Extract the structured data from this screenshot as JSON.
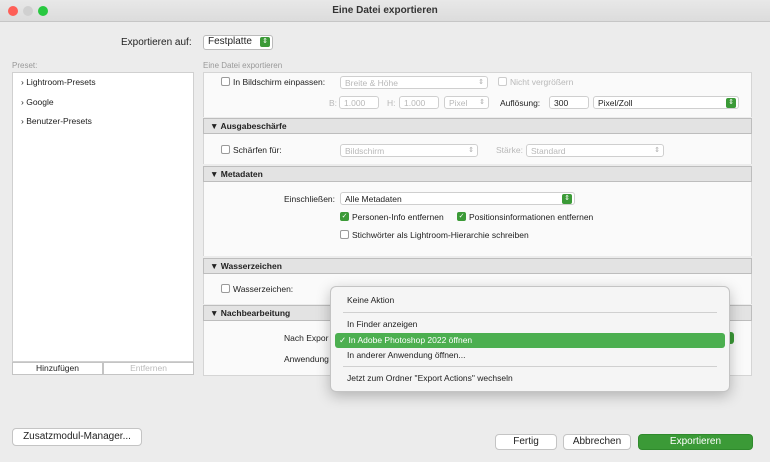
{
  "window": {
    "title": "Eine Datei exportieren"
  },
  "export_to": {
    "label": "Exportieren auf:",
    "value": "Festplatte"
  },
  "preset": {
    "header": "Preset:",
    "items": [
      "Lightroom-Presets",
      "Google",
      "Benutzer-Presets"
    ],
    "add_label": "Hinzufügen",
    "remove_label": "Entfernen"
  },
  "right_header": "Eine Datei exportieren",
  "sizing": {
    "fit_label": "In Bildschirm einpassen:",
    "fit_value": "Breite & Höhe",
    "no_enlarge_label": "Nicht vergrößern",
    "b_label": "B:",
    "b_value": "1.000",
    "h_label": "H:",
    "h_value": "1.000",
    "unit": "Pixel",
    "resolution_label": "Auflösung:",
    "resolution_value": "300",
    "resolution_unit": "Pixel/Zoll"
  },
  "sharpening": {
    "header": "Ausgabeschärfe",
    "sharpen_label": "Schärfen für:",
    "sharpen_value": "Bildschirm",
    "strength_label": "Stärke:",
    "strength_value": "Standard"
  },
  "metadata": {
    "header": "Metadaten",
    "include_label": "Einschließen:",
    "include_value": "Alle Metadaten",
    "remove_person": "Personen-Info entfernen",
    "remove_location": "Positionsinformationen entfernen",
    "keywords_hierarchy": "Stichwörter als Lightroom-Hierarchie schreiben"
  },
  "watermark": {
    "header": "Wasserzeichen",
    "label": "Wasserzeichen:"
  },
  "post_processing": {
    "header": "Nachbearbeitung",
    "after_export_label": "Nach Expor",
    "application_label": "Anwendung"
  },
  "menu": {
    "items": [
      "Keine Aktion",
      "In Finder anzeigen",
      "✓ In Adobe Photoshop 2022 öffnen",
      "In anderer Anwendung öffnen...",
      "Jetzt zum Ordner \"Export Actions\" wechseln"
    ]
  },
  "footer": {
    "plugin_manager": "Zusatzmodul-Manager...",
    "done": "Fertig",
    "cancel": "Abbrechen",
    "export": "Exportieren"
  },
  "colors": {
    "accent_green": "#3b9a37",
    "highlight": "#4caf50"
  }
}
